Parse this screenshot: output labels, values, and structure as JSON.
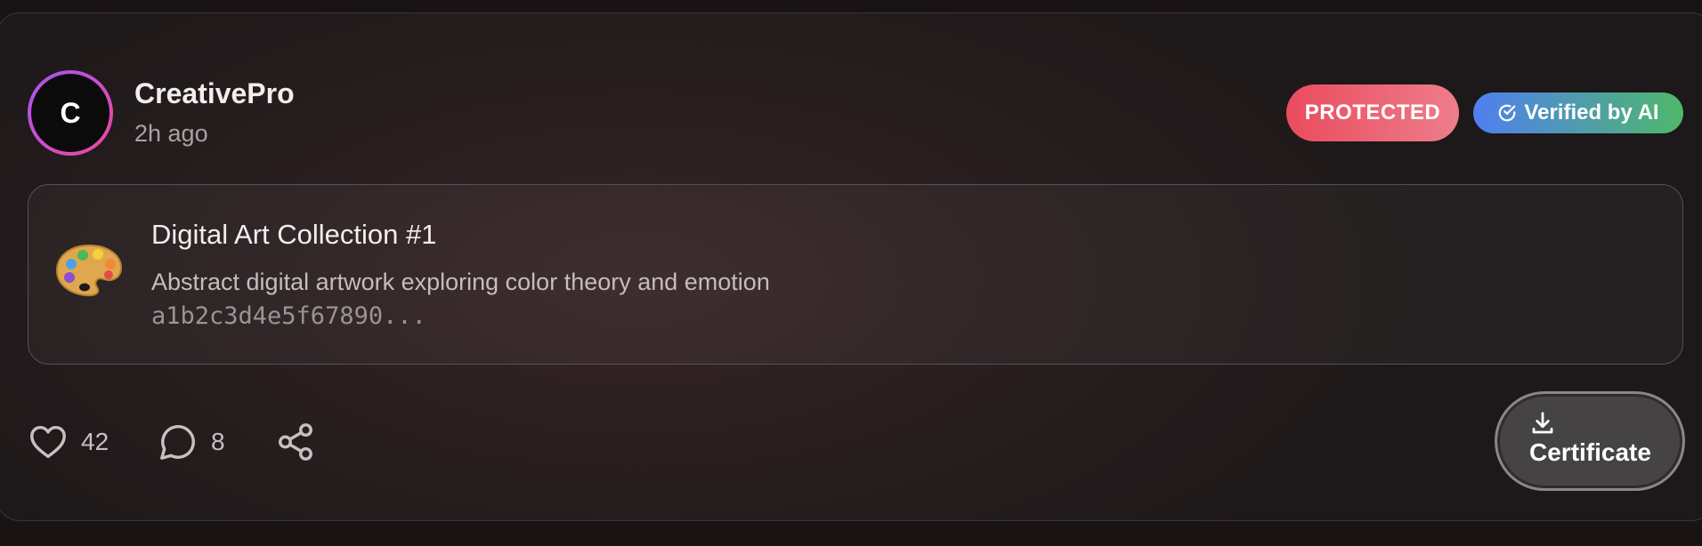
{
  "post": {
    "avatar_initial": "C",
    "username": "CreativePro",
    "time": "2h ago"
  },
  "badges": {
    "protected": "PROTECTED",
    "verified": "Verified by AI"
  },
  "asset": {
    "icon": "palette-emoji",
    "title": "Digital Art Collection #1",
    "description": "Abstract digital artwork exploring color theory and emotion",
    "hash": "a1b2c3d4e5f67890..."
  },
  "actions": {
    "likes": "42",
    "comments": "8",
    "certificate_label": "Certificate"
  },
  "colors": {
    "protected_badge": "#e94c5e",
    "verified_start": "#4f7ff0",
    "verified_end": "#4fb86a",
    "avatar_ring_start": "#a855f7",
    "avatar_ring_end": "#ec4899"
  }
}
